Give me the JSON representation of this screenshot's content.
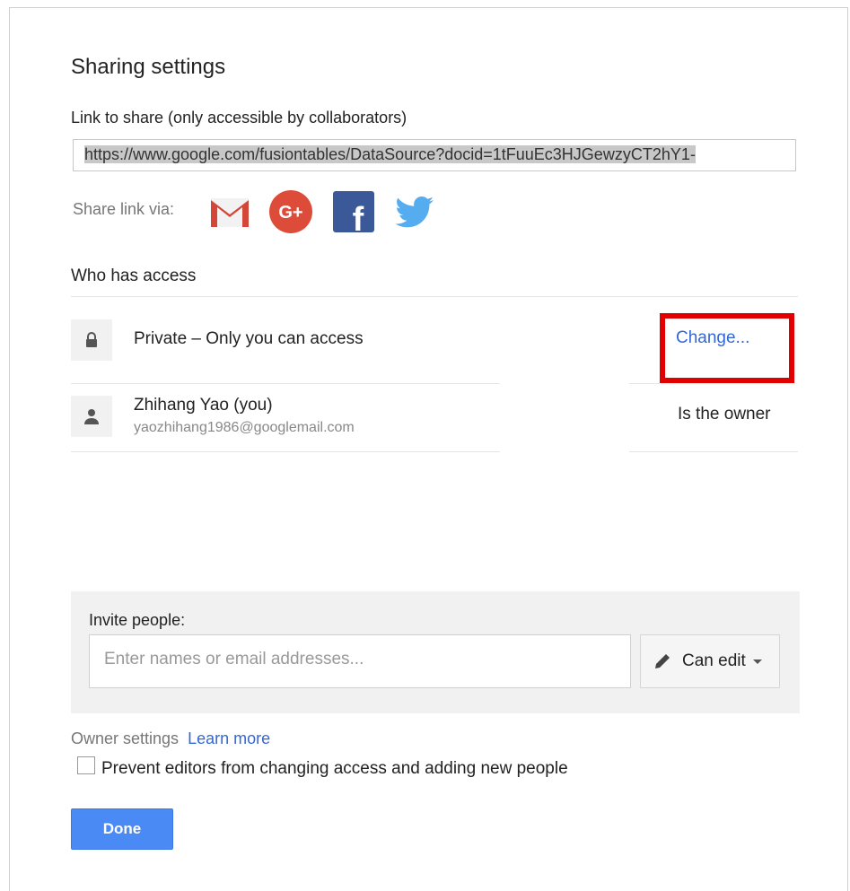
{
  "dialog": {
    "title": "Sharing settings",
    "link_label": "Link to share (only accessible by collaborators)",
    "link_url": "https://www.google.com/fusiontables/DataSource?docid=1tFuuEc3HJGewzyCT2hY1-",
    "share_via_label": "Share link via:",
    "share_targets": [
      "gmail-icon",
      "google-plus-icon",
      "facebook-icon",
      "twitter-icon"
    ],
    "who_has_access_label": "Who has access",
    "access": {
      "visibility_text": "Private – Only you can access",
      "change_label": "Change...",
      "owner_name": "Zhihang Yao (you)",
      "owner_email": "yaozhihang1986@googlemail.com",
      "owner_role": "Is the owner"
    },
    "invite": {
      "label": "Invite people:",
      "placeholder": "Enter names or email addresses...",
      "permission": "Can edit"
    },
    "owner_settings": {
      "label": "Owner settings",
      "learn_more": "Learn more",
      "checkbox_label": "Prevent editors from changing access and adding new people",
      "checked": false
    },
    "done_label": "Done"
  },
  "colors": {
    "accent": "#3367d6",
    "primary_button": "#4a8af4",
    "highlight": "#e00000"
  }
}
